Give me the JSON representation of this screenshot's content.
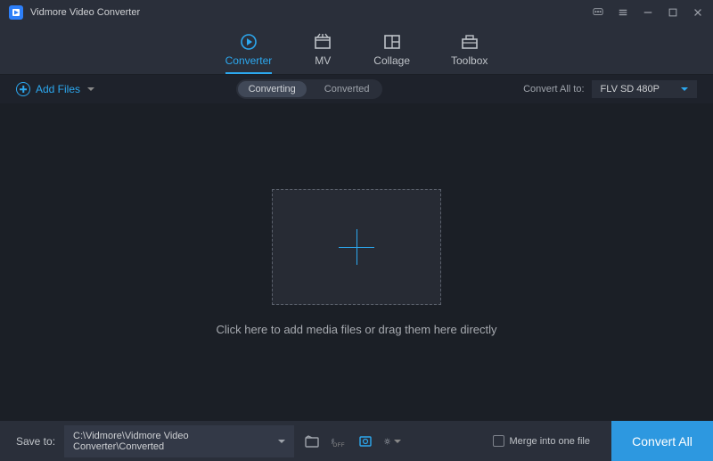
{
  "app_title": "Vidmore Video Converter",
  "tabs": {
    "converter": "Converter",
    "mv": "MV",
    "collage": "Collage",
    "toolbox": "Toolbox"
  },
  "toolbar": {
    "add_files": "Add Files",
    "converting": "Converting",
    "converted": "Converted",
    "convert_all_to": "Convert All to:",
    "format_value": "FLV SD 480P"
  },
  "drop_hint": "Click here to add media files or drag them here directly",
  "bottom": {
    "save_to": "Save to:",
    "path": "C:\\Vidmore\\Vidmore Video Converter\\Converted",
    "merge": "Merge into one file",
    "convert_all": "Convert All",
    "hwaccel_state": "OFF"
  }
}
